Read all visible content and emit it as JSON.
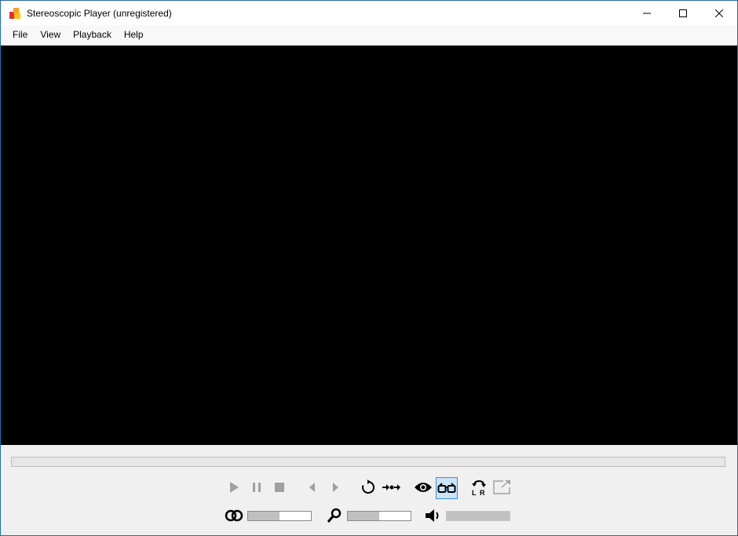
{
  "window": {
    "title": "Stereoscopic Player (unregistered)",
    "accent": "#2b6c9e"
  },
  "menu": {
    "items": [
      {
        "id": "file",
        "label": "File"
      },
      {
        "id": "view",
        "label": "View"
      },
      {
        "id": "playback",
        "label": "Playback"
      },
      {
        "id": "help",
        "label": "Help"
      }
    ]
  },
  "controls": {
    "transport_icons": [
      "play-icon",
      "pause-icon",
      "stop-icon",
      "previous-frame-icon",
      "next-frame-icon",
      "loop-icon",
      "step-icon",
      "eye-icon",
      "glasses-icon",
      "swap-lr-icon",
      "fullscreen-icon"
    ],
    "swap_labels": {
      "left": "L",
      "right": "R"
    },
    "active_button": "glasses-icon"
  },
  "sliders": {
    "parallax": {
      "icon": "parallax-icon",
      "value": 0.5
    },
    "zoom": {
      "icon": "zoom-icon",
      "value": 0.5
    },
    "volume": {
      "icon": "volume-icon",
      "value": 1.0,
      "disabled": true
    }
  },
  "progress": {
    "value": 0
  }
}
